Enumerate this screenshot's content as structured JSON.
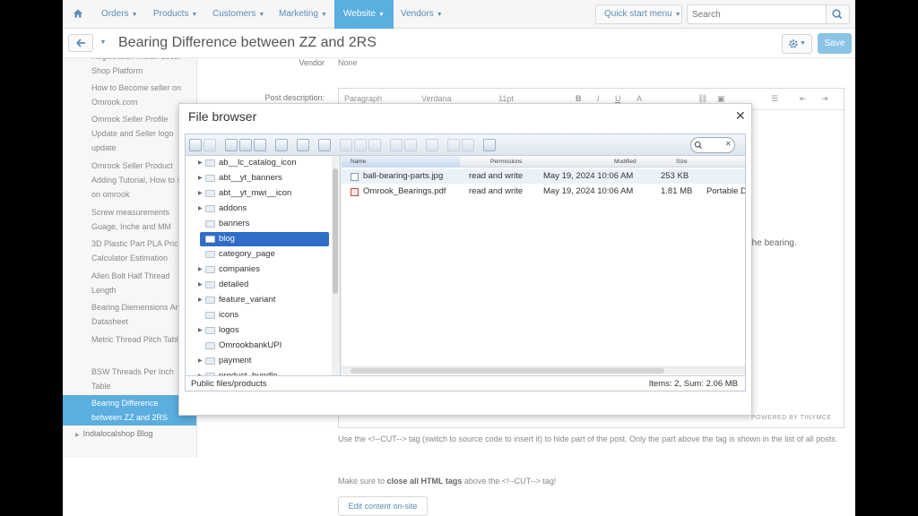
{
  "nav": {
    "items": [
      "Orders",
      "Products",
      "Customers",
      "Marketing",
      "Website",
      "Vendors"
    ],
    "active": "Website",
    "quick_start": "Quick start menu",
    "search_placeholder": "Search"
  },
  "titlebar": {
    "title": "Bearing Difference between ZZ and 2RS",
    "save": "Save"
  },
  "sidebar": {
    "items": [
      "Registration Indian Local Shop Platform",
      "How to Become seller on Omrook.com",
      "Omrook Seller Profile Update and Seller logo update",
      "Omrook Seller Product Adding Tutorial, How to sell on omrook",
      "Screw measurements Guage, Inche and MM",
      "3D Plastic Part PLA Price Calculator Estimation",
      "Allen Bolt Half Thread Length",
      "Bearing Diemensions And Datasheet",
      "Metric Thread Pitch Table",
      "BSW Threads Per Inch Table"
    ],
    "active": "Bearing Difference between ZZ and 2RS",
    "blog": "Indialocalshop Blog"
  },
  "form": {
    "vendor_label": "Vendor",
    "vendor_value": "None",
    "description_label": "Post description:"
  },
  "editor": {
    "format": "Paragraph",
    "font": "Verdana",
    "size": "11pt",
    "visible_text": "ng the bearing.",
    "powered": "POWERED BY TINYMCE"
  },
  "notes": {
    "cut_note": "Use the <!--CUT--> tag (switch to source code to insert it) to hide part of the post. Only the part above the tag is shown in the list of all posts.",
    "close_note_pre": "Make sure to ",
    "close_note_bold": "close all HTML tags",
    "close_note_post": " above the <!--CUT--> tag!",
    "edit_onsite": "Edit content on-site"
  },
  "file_browser": {
    "title": "File browser",
    "tree": [
      {
        "label": "ab__lc_catalog_icon",
        "expandable": true
      },
      {
        "label": "abt__yt_banners",
        "expandable": true
      },
      {
        "label": "abt__yt_mwi__icon",
        "expandable": true
      },
      {
        "label": "addons",
        "expandable": true
      },
      {
        "label": "banners",
        "expandable": false
      },
      {
        "label": "blog",
        "expandable": false,
        "selected": true
      },
      {
        "label": "category_page",
        "expandable": false
      },
      {
        "label": "companies",
        "expandable": true
      },
      {
        "label": "detailed",
        "expandable": true
      },
      {
        "label": "feature_variant",
        "expandable": true
      },
      {
        "label": "icons",
        "expandable": false
      },
      {
        "label": "logos",
        "expandable": true
      },
      {
        "label": "OmrookbankUPI",
        "expandable": false
      },
      {
        "label": "payment",
        "expandable": true
      },
      {
        "label": "product_bundle",
        "expandable": true
      }
    ],
    "columns": [
      "Name",
      "Permissions",
      "Modified",
      "Size"
    ],
    "files": [
      {
        "name": "ball-bearing-parts.jpg",
        "permissions": "read and write",
        "modified": "May 19, 2024 10:06 AM",
        "size": "253 KB",
        "kind": "",
        "icon": "image-file-icon"
      },
      {
        "name": "Omrook_Bearings.pdf",
        "permissions": "read and write",
        "modified": "May 19, 2024 10:06 AM",
        "size": "1.81 MB",
        "kind": "Portable D",
        "icon": "pdf-file-icon"
      }
    ],
    "status_path": "Public files/products",
    "status_items": "Items: 2, Sum: 2.06 MB"
  }
}
